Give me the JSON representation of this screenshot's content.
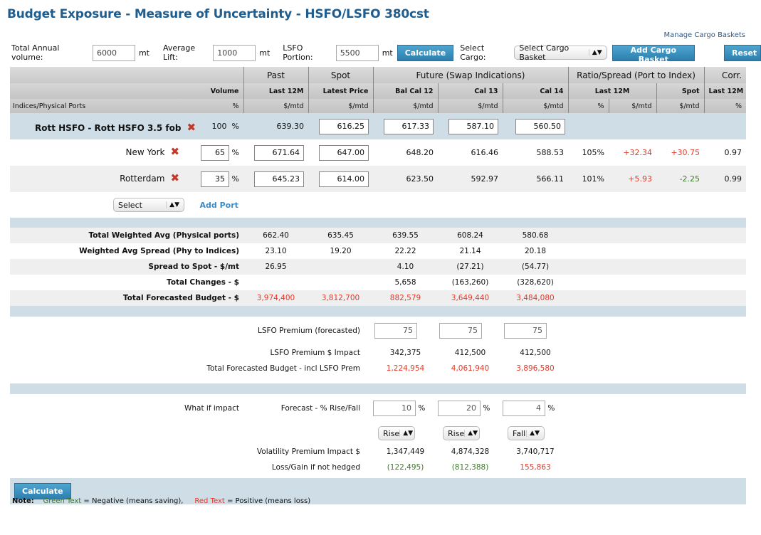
{
  "title": "Budget Exposure - Measure of Uncertainty - HSFO/LSFO 380cst",
  "manage_link": "Manage Cargo Baskets",
  "controls": {
    "total_label": "Total Annual volume:",
    "total_value": "6000",
    "avg_label": "Average Lift:",
    "avg_value": "1000",
    "lsfo_label": "LSFO Portion:",
    "lsfo_value": "5500",
    "unit": "mt",
    "calculate": "Calculate",
    "cargo_label": "Select Cargo:",
    "cargo_select": "Select Cargo Basket",
    "add_basket": "Add Cargo Basket",
    "reset": "Reset"
  },
  "header": {
    "groups": [
      "Past",
      "Spot",
      "Future (Swap Indications)",
      "Ratio/Spread (Port to Index)",
      "Corr."
    ],
    "row2": [
      "Volume",
      "Last 12M",
      "Latest Price",
      "Bal Cal 12",
      "Cal 13",
      "Cal 14",
      "Last 12M",
      "Spot",
      "Last 12M"
    ],
    "row3": [
      "Indices/Physical Ports",
      "%",
      "$/mtd",
      "$/mtd",
      "$/mtd",
      "$/mtd",
      "$/mtd",
      "%",
      "$/mtd",
      "$/mtd",
      "%"
    ]
  },
  "index_row": {
    "name": "Rott HSFO - Rott HSFO 3.5 fob",
    "volume": "100",
    "pct": "%",
    "past": "639.30",
    "spot": "616.25",
    "bal": "617.33",
    "cal13": "587.10",
    "cal14": "560.50"
  },
  "ports": [
    {
      "name": "New York",
      "volume": "65",
      "past": "671.64",
      "spot": "647.00",
      "bal": "648.20",
      "cal13": "616.46",
      "cal14": "588.53",
      "ratio": "105%",
      "spread": "+32.34",
      "spot_spread": "+30.75",
      "corr": "0.97"
    },
    {
      "name": "Rotterdam",
      "volume": "35",
      "past": "645.23",
      "spot": "614.00",
      "bal": "623.50",
      "cal13": "592.97",
      "cal14": "566.11",
      "ratio": "101%",
      "spread": "+5.93",
      "spot_spread": "-2.25",
      "corr": "0.99"
    }
  ],
  "add_port": {
    "select": "Select",
    "label": "Add Port"
  },
  "summary": [
    {
      "label": "Total Weighted Avg (Physical ports)",
      "v": [
        "662.40",
        "635.45",
        "639.55",
        "608.24",
        "580.68"
      ]
    },
    {
      "label": "Weighted Avg Spread (Phy to Indices)",
      "v": [
        "23.10",
        "19.20",
        "22.22",
        "21.14",
        "20.18"
      ]
    },
    {
      "label": "Spread to Spot - $/mt",
      "v": [
        "26.95",
        "",
        "4.10",
        "(27.21)",
        "(54.77)"
      ]
    },
    {
      "label": "Total Changes - $",
      "v": [
        "",
        "",
        "5,658",
        "(163,260)",
        "(328,620)"
      ]
    },
    {
      "label": "Total Forecasted Budget - $",
      "v": [
        "3,974,400",
        "3,812,700",
        "882,579",
        "3,649,440",
        "3,484,080"
      ]
    }
  ],
  "lsfo": {
    "premium_label": "LSFO Premium (forecasted)",
    "premium": [
      "75",
      "75",
      "75"
    ],
    "impact_label": "LSFO Premium $ Impact",
    "impact": [
      "342,375",
      "412,500",
      "412,500"
    ],
    "budget_label": "Total Forecasted Budget - incl LSFO Prem",
    "budget": [
      "1,224,954",
      "4,061,940",
      "3,896,580"
    ]
  },
  "whatif": {
    "label": "What if impact",
    "forecast_label": "Forecast - % Rise/Fall",
    "pcts": [
      "10",
      "20",
      "4"
    ],
    "dirs": [
      "Rise",
      "Rise",
      "Fall"
    ],
    "vol_label": "Volatility Premium Impact $",
    "vol": [
      "1,347,449",
      "4,874,328",
      "3,740,717"
    ],
    "loss_label": "Loss/Gain if not hedged",
    "loss": [
      "(122,495)",
      "(812,388)",
      "155,863"
    ]
  },
  "calculate_bottom": "Calculate",
  "note": {
    "label": "Note:",
    "green": "Green Text",
    "green_desc": "= Negative (means saving),",
    "red": "Red Text",
    "red_desc": "= Positive (means loss)"
  },
  "colors": {
    "title": "#1f5d8f",
    "positive": "#e23a2a",
    "negative": "#3d7a2a",
    "band": "#cfdee6"
  }
}
